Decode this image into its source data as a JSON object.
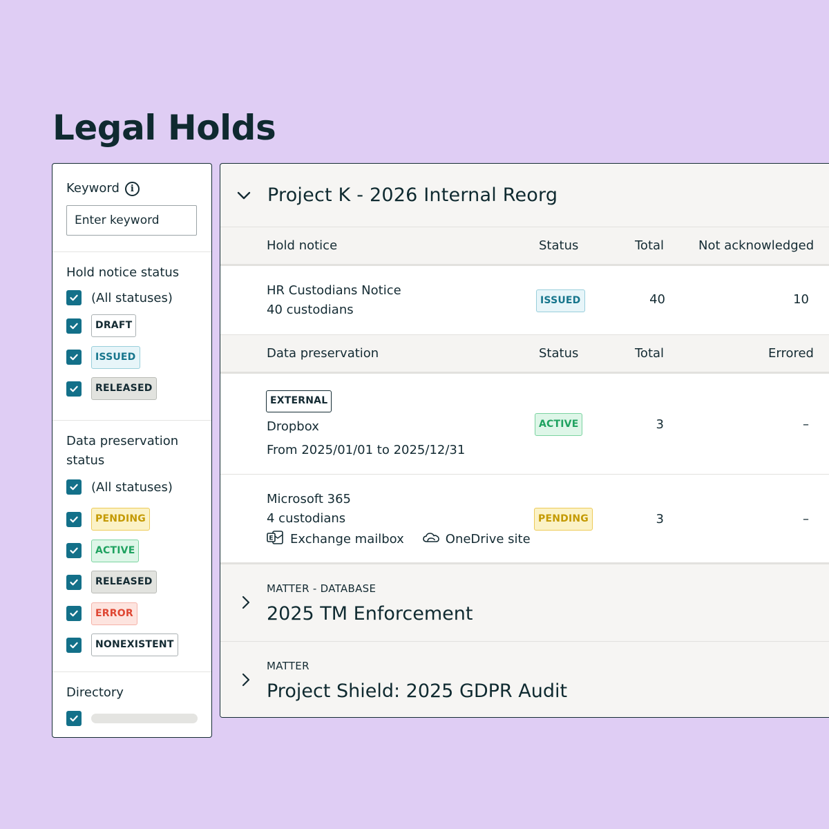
{
  "page": {
    "title": "Legal Holds"
  },
  "filters": {
    "keyword": {
      "label": "Keyword",
      "placeholder": "Enter keyword",
      "value": ""
    },
    "hold_notice_status": {
      "heading": "Hold notice status",
      "all_label": "(All statuses)",
      "options": [
        "DRAFT",
        "ISSUED",
        "RELEASED"
      ]
    },
    "data_preservation_status": {
      "heading_line1": "Data preservation",
      "heading_line2": "status",
      "all_label": "(All statuses)",
      "options": [
        "PENDING",
        "ACTIVE",
        "RELEASED",
        "ERROR",
        "NONEXISTENT"
      ]
    },
    "directory": {
      "heading": "Directory"
    }
  },
  "matters": {
    "expanded": {
      "title": "Project K - 2026 Internal Reorg",
      "hold_notice_table": {
        "columns": [
          "Hold notice",
          "Status",
          "Total",
          "Not acknowledged"
        ],
        "rows": [
          {
            "name": "HR Custodians Notice",
            "sub": "40 custodians",
            "status": "ISSUED",
            "total": "40",
            "not_acknowledged": "10"
          }
        ]
      },
      "data_preservation_table": {
        "columns": [
          "Data preservation",
          "Status",
          "Total",
          "Errored"
        ],
        "rows": [
          {
            "tag": "EXTERNAL",
            "name": "Dropbox",
            "sub": "From 2025/01/01 to 2025/12/31",
            "status": "ACTIVE",
            "total": "3",
            "errored": "–"
          },
          {
            "name": "Microsoft 365",
            "sub": "4 custodians",
            "source1": "Exchange mailbox",
            "source2": "OneDrive site",
            "status": "PENDING",
            "total": "3",
            "errored": "–"
          }
        ]
      }
    },
    "collapsed": [
      {
        "kind": "MATTER - DATABASE",
        "name": "2025 TM Enforcement"
      },
      {
        "kind": "MATTER",
        "name": "Project Shield: 2025 GDPR Audit"
      }
    ]
  },
  "icons": {
    "checkbox": "check-icon",
    "info": "info-icon",
    "expand": "chevron-down-icon",
    "collapse": "chevron-right-icon",
    "exchange": "exchange-icon",
    "onedrive": "cloud-icon"
  },
  "colors": {
    "background": "#dfcdf4",
    "checkbox": "#137089",
    "text": "#142b33"
  }
}
